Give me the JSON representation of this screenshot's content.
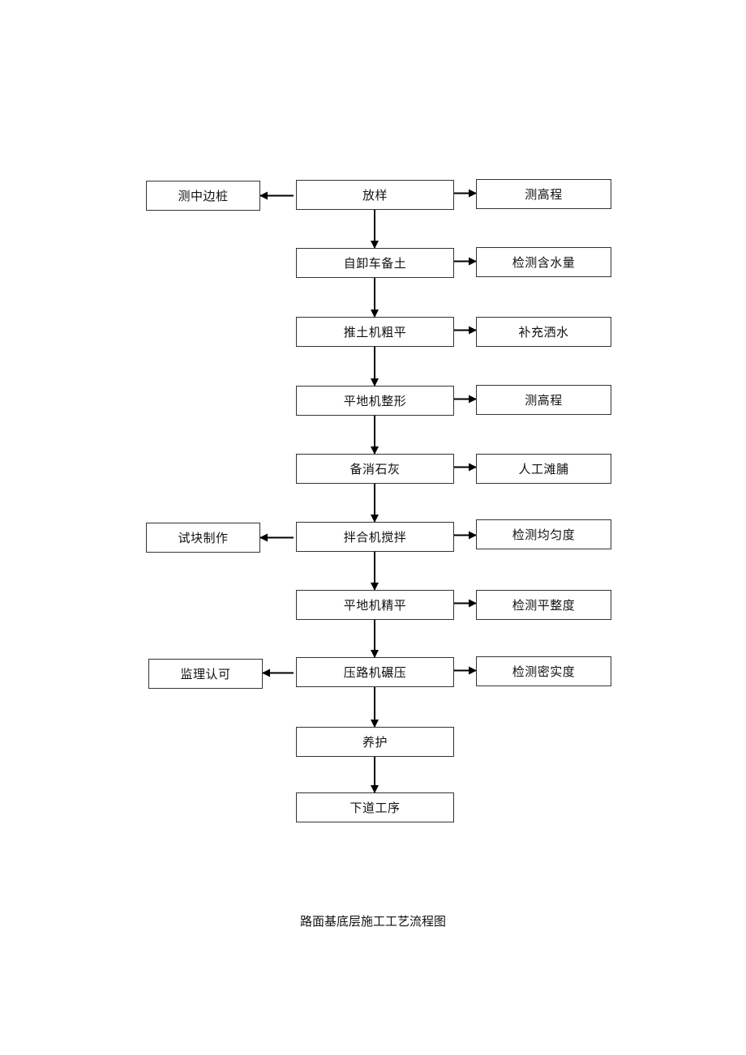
{
  "diagram": {
    "type": "flowchart",
    "main_steps": [
      {
        "id": "m0",
        "label": "放样"
      },
      {
        "id": "m1",
        "label": "自卸车备土"
      },
      {
        "id": "m2",
        "label": "推土机粗平"
      },
      {
        "id": "m3",
        "label": "平地机整形"
      },
      {
        "id": "m4",
        "label": "备消石灰"
      },
      {
        "id": "m5",
        "label": "拌合机搅拌"
      },
      {
        "id": "m6",
        "label": "平地机精平"
      },
      {
        "id": "m7",
        "label": "压路机碾压"
      },
      {
        "id": "m8",
        "label": "养护"
      },
      {
        "id": "m9",
        "label": "下道工序"
      }
    ],
    "right_steps": [
      {
        "from": "m0",
        "label": "测高程"
      },
      {
        "from": "m1",
        "label": "检测含水量"
      },
      {
        "from": "m2",
        "label": "补充洒水"
      },
      {
        "from": "m3",
        "label": "测高程"
      },
      {
        "from": "m4",
        "label": "人工滩脯"
      },
      {
        "from": "m5",
        "label": "检测均匀度"
      },
      {
        "from": "m6",
        "label": "检测平整度"
      },
      {
        "from": "m7",
        "label": "检测密实度"
      }
    ],
    "left_steps": [
      {
        "from": "m0",
        "label": "测中边桩"
      },
      {
        "from": "m5",
        "label": "试块制作"
      },
      {
        "from": "m7",
        "label": "监理认可"
      }
    ],
    "caption": "路面基底层施工工艺流程图"
  }
}
